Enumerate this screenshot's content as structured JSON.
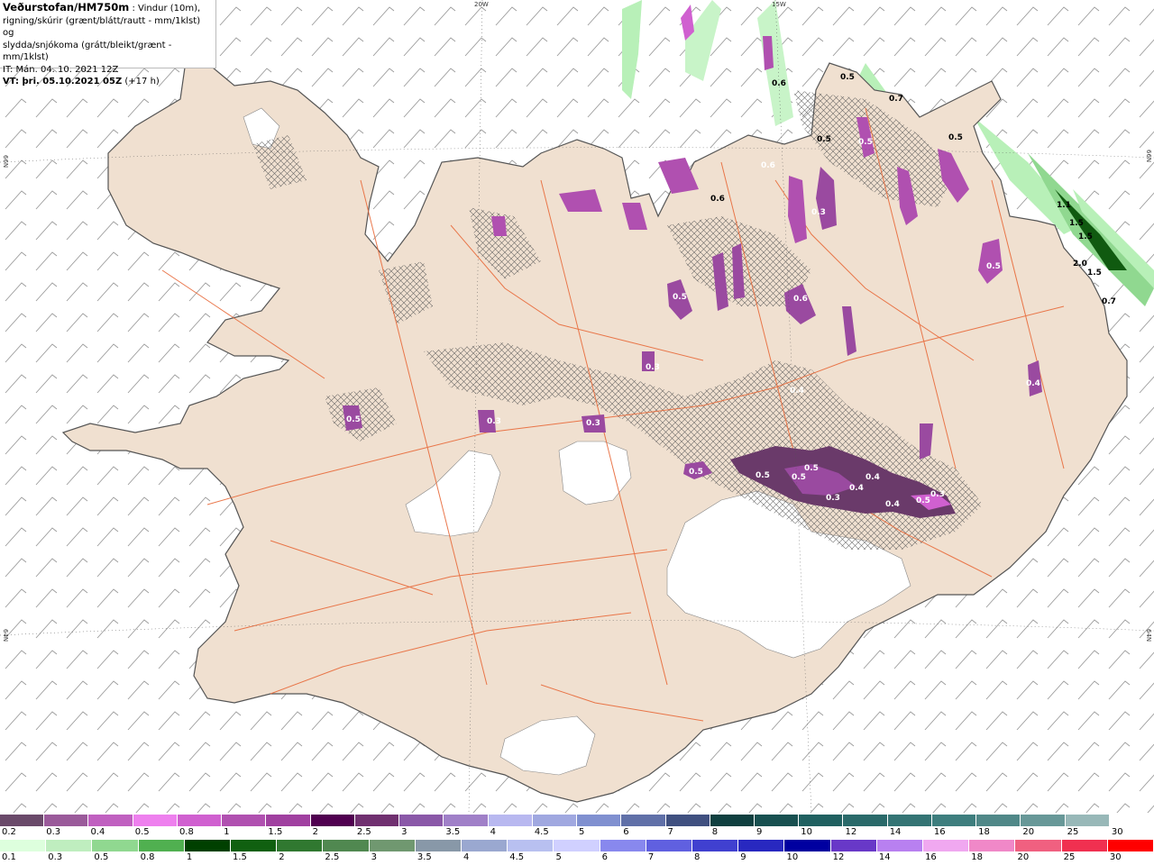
{
  "header": {
    "brand": "Veðurstofan/HM750m",
    "line1_suffix": ": Vindur (10m),",
    "line2": "rigning/skúrir (grænt/blátt/rautt - mm/1klst) og",
    "line3": "slydda/snjókoma (grátt/bleikt/grænt - mm/1klst)",
    "it_line": "IT: Mán. 04. 10. 2021 12Z",
    "vt_label": "VT: þri. 05.10.2021 05Z",
    "vt_offset": "(+17 h)"
  },
  "grid_labels": {
    "lon_20w": "20W",
    "lon_15w": "15W",
    "lat_66n_left": "66N",
    "lat_66n_right": "66N",
    "lat_64n_left": "64N",
    "lat_64n_right": "64N"
  },
  "precip_labels": [
    "0.5",
    "0.6",
    "0.7",
    "0.6",
    "0.5",
    "0.5",
    "1.1",
    "1.5",
    "1.5",
    "2.0",
    "1.5",
    "0.7",
    "0.6",
    "0.3",
    "0.5",
    "0.4",
    "0.3",
    "0.3",
    "0.5",
    "0.5",
    "0.5",
    "0.4",
    "0.4",
    "0.3",
    "0.4",
    "0.5",
    "0.5",
    "0.3",
    "0.5",
    "0.4",
    "0.5",
    "0.6",
    "0.3",
    "0.5"
  ],
  "legend_snow": {
    "labels": [
      "0.2",
      "0.3",
      "0.4",
      "0.5",
      "0.8",
      "1",
      "1.5",
      "2",
      "2.5",
      "3",
      "3.5",
      "4",
      "4.5",
      "5",
      "6",
      "7",
      "8",
      "9",
      "10",
      "12",
      "14",
      "16",
      "18",
      "20",
      "25",
      "30"
    ],
    "colors": [
      "#6a4a6a",
      "#9a5a9a",
      "#c060c0",
      "#ee80ee",
      "#d060d0",
      "#b050b0",
      "#a040a0",
      "#500050",
      "#703070",
      "#8a58a8",
      "#a080c8",
      "#b8b8f0",
      "#a0a8e0",
      "#8090d0",
      "#6070a8",
      "#405080",
      "#104040",
      "#185050",
      "#206060",
      "#2a6a6a",
      "#347474",
      "#3e7e7e",
      "#508888",
      "#689898",
      "#98b8b8",
      "#ffffff"
    ]
  },
  "legend_rain": {
    "labels": [
      "0.1",
      "0.3",
      "0.5",
      "0.8",
      "1",
      "1.5",
      "2",
      "2.5",
      "3",
      "3.5",
      "4",
      "4.5",
      "5",
      "6",
      "7",
      "8",
      "9",
      "10",
      "12",
      "14",
      "16",
      "18",
      "20",
      "25",
      "30"
    ],
    "colors": [
      "#ddffdd",
      "#bfeebf",
      "#90d890",
      "#50b050",
      "#004000",
      "#106010",
      "#307830",
      "#508850",
      "#709870",
      "#8898a8",
      "#9aa8d0",
      "#b8c0f0",
      "#d0d0ff",
      "#8888ee",
      "#6060e0",
      "#4040d0",
      "#2828c0",
      "#0000a0",
      "#6838c8",
      "#b880f0",
      "#f0a8f0",
      "#f088c8",
      "#f06080",
      "#f03050",
      "#ff0000"
    ]
  },
  "colors": {
    "land": "#f0e0d0",
    "coast": "#555555",
    "roads": "#e86a3a",
    "ice": "#ffffff",
    "rain_light": "#b8f0b8",
    "rain_dark": "#105a10",
    "snow_purple": "#9a4aa0",
    "snow_dark": "#6a3a6a"
  }
}
